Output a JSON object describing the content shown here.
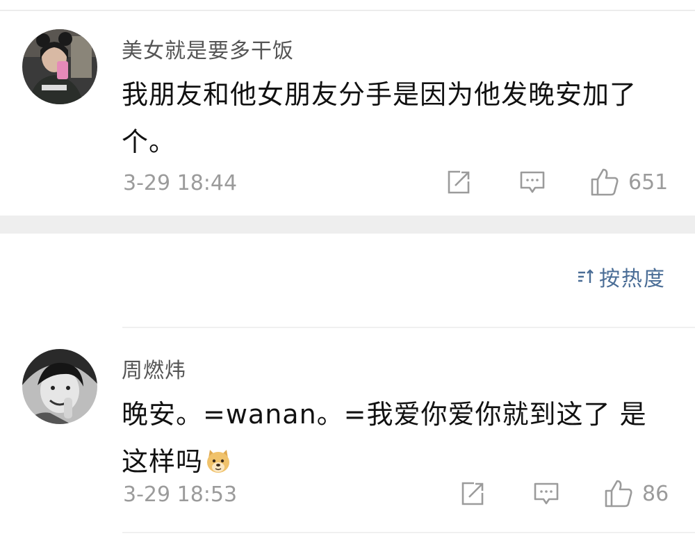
{
  "comments": [
    {
      "username": "美女就是要多干饭",
      "text": "我朋友和他女朋友分手是因为他发晚安加了个。",
      "timestamp": "3-29 18:44",
      "likes": "651",
      "avatar_icon": "avatar-photo"
    },
    {
      "username": "周燃炜",
      "text": "晚安。=wanan。=我爱你爱你就到这了 是这样吗",
      "emoji": "doge-emoji",
      "timestamp": "3-29 18:53",
      "likes": "86",
      "avatar_icon": "avatar-photo"
    }
  ],
  "sort": {
    "label": "按热度",
    "icon": "sort-icon"
  },
  "icons": {
    "share": "share-icon",
    "reply": "comment-icon",
    "like": "thumbs-up-icon"
  },
  "colors": {
    "accent": "#4a6d96",
    "meta": "#9b9b9b",
    "username": "#555555",
    "body": "#111111",
    "separator": "#eeeeee"
  }
}
